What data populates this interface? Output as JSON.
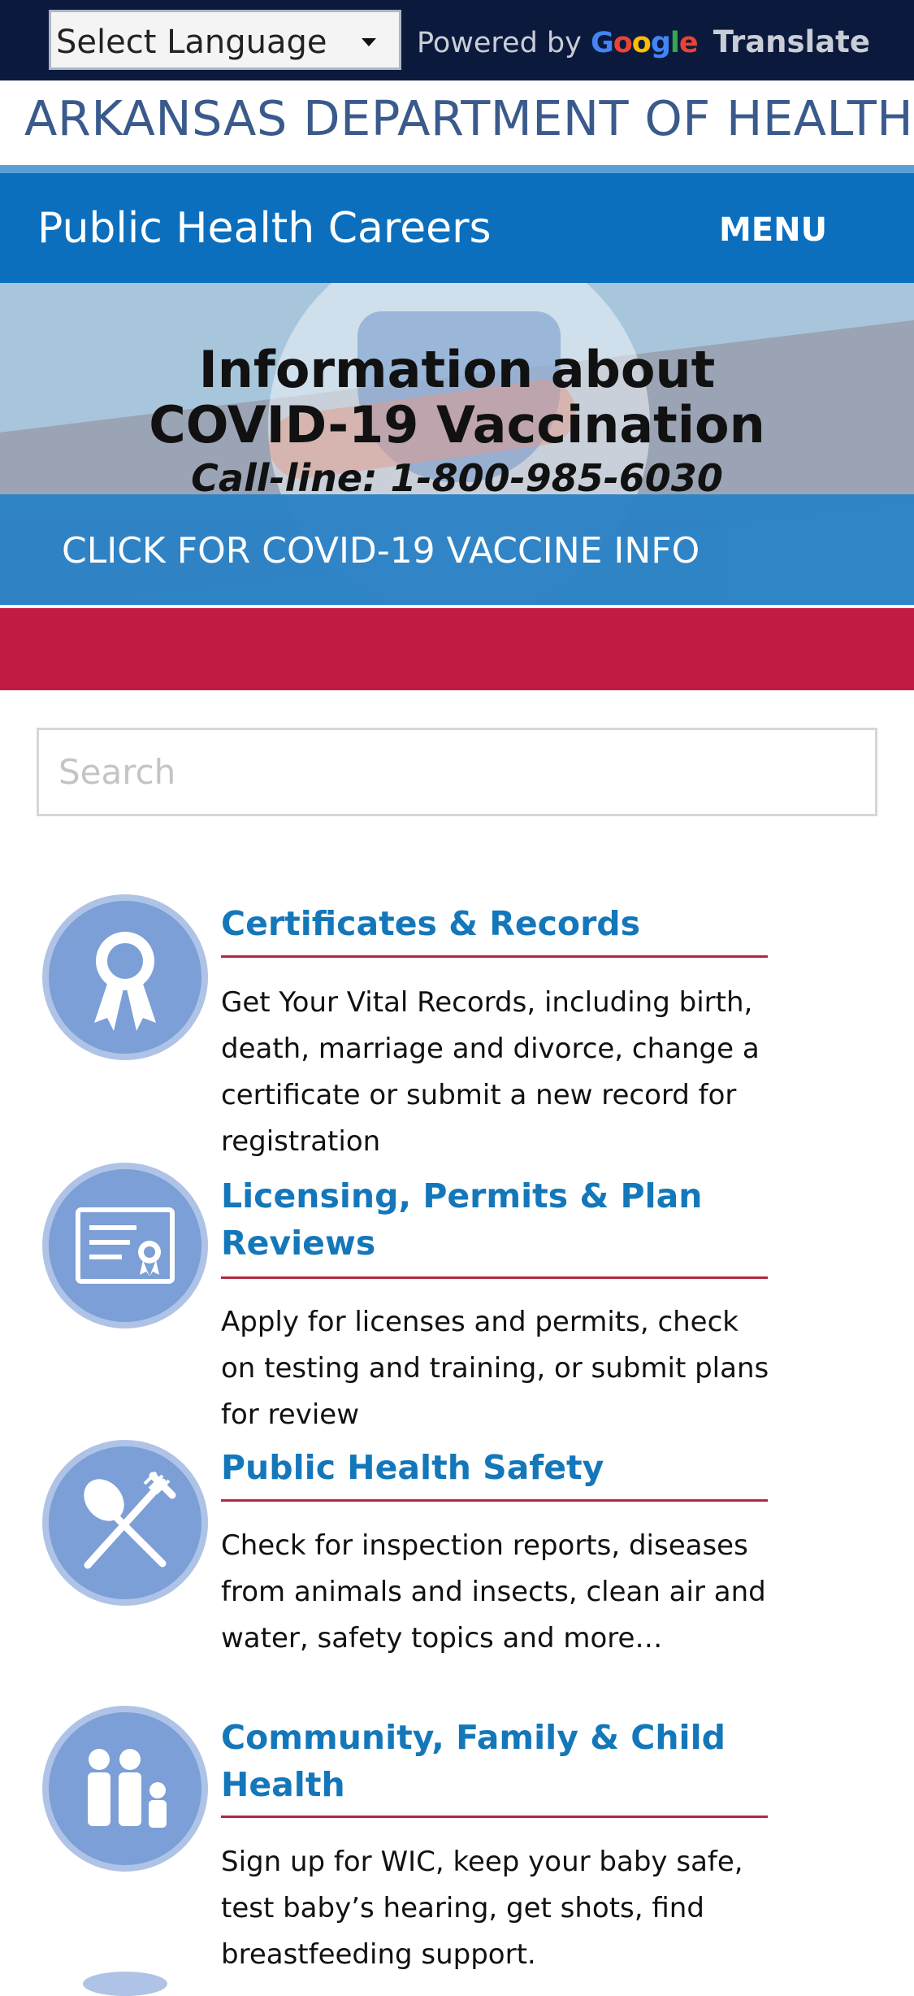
{
  "translate": {
    "select_label": "Select Language",
    "powered_by": "Powered by",
    "google": "Google",
    "translate": "Translate"
  },
  "header": {
    "department": "ARKANSAS DEPARTMENT OF HEALTH"
  },
  "nav": {
    "title": "Public Health Careers",
    "menu": "MENU"
  },
  "hero": {
    "line1": "Information about",
    "line2": "COVID-19 Vaccination",
    "line3": "Call-line: 1-800-985-6030",
    "cta": "CLICK FOR COVID-19 VACCINE INFO"
  },
  "search": {
    "placeholder": "Search"
  },
  "sections": [
    {
      "icon": "ribbon-award-icon",
      "title": "Certificates & Records",
      "description": "Get Your Vital Records, including birth, death, marriage and divorce, change a certificate or submit a new record for registration"
    },
    {
      "icon": "certificate-document-icon",
      "title": "Licensing, Permits & Plan Reviews",
      "description": "Apply for licenses and permits, check on testing and training, or submit plans for review"
    },
    {
      "icon": "spoon-fork-icon",
      "title": "Public Health Safety",
      "description": "Check for inspection reports, diseases from animals and insects, clean air and water, safety topics and more…"
    },
    {
      "icon": "family-icon",
      "title": "Community, Family & Child Health",
      "description": "Sign up for WIC, keep your baby safe, test baby’s hearing, get shots, find breastfeeding support."
    }
  ],
  "colors": {
    "topbar": "#0b1a3c",
    "nav": "#0b6fbe",
    "cta": "#2b82c6",
    "red_band": "#c21b43",
    "link": "#1477ba",
    "rule": "#b4283f",
    "icon_bg": "#7b9fd6"
  }
}
